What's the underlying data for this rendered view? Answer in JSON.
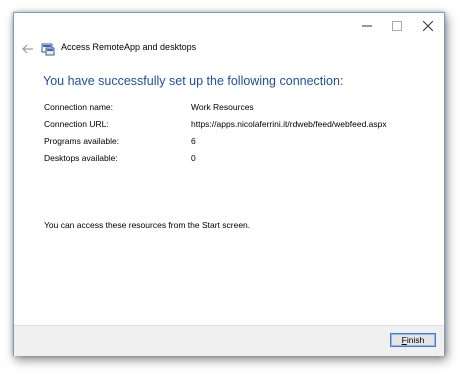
{
  "window": {
    "title": "Access RemoteApp and desktops",
    "controls": {
      "minimize_icon": "minimize-icon",
      "maximize_icon": "maximize-icon",
      "close_icon": "close-icon"
    },
    "back_icon": "back-arrow-icon",
    "app_icon": "remoteapp-icon"
  },
  "main": {
    "heading": "You have successfully set up the following connection:",
    "details": [
      {
        "label": "Connection name:",
        "value": "Work Resources"
      },
      {
        "label": "Connection URL:",
        "value": "https://apps.nicolaferrini.it/rdweb/feed/webfeed.aspx"
      },
      {
        "label": "Programs available:",
        "value": "6"
      },
      {
        "label": "Desktops available:",
        "value": "0"
      }
    ],
    "info": "You can access these resources from the Start screen."
  },
  "footer": {
    "finish_mnemonic": "F",
    "finish_rest": "inish"
  },
  "colors": {
    "heading": "#1e4f9a",
    "footer_bg": "#f0f0f0",
    "button_border": "#3c7fd1"
  }
}
